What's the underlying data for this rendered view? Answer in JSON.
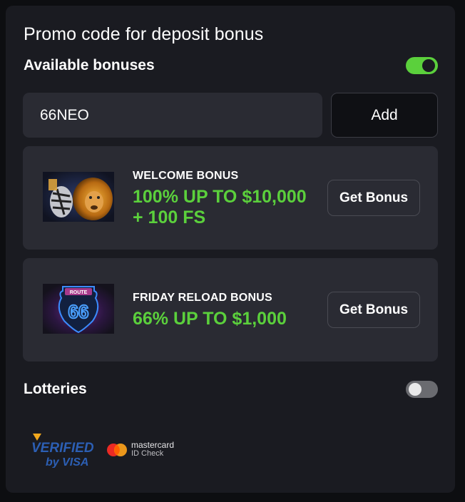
{
  "header": {
    "title": "Promo code for deposit bonus"
  },
  "bonuses_section": {
    "label": "Available bonuses",
    "toggle_on": true
  },
  "promo": {
    "value": "66NEO",
    "add_label": "Add"
  },
  "cards": [
    {
      "caption": "WELCOME BONUS",
      "offer": "100% UP TO $10,000 + 100 FS",
      "button": "Get Bonus",
      "image": "lions-icon"
    },
    {
      "caption": "FRIDAY RELOAD BONUS",
      "offer": "66% UP TO $1,000",
      "button": "Get Bonus",
      "image": "route-66-icon"
    }
  ],
  "lotteries": {
    "label": "Lotteries",
    "toggle_on": false
  },
  "footer": {
    "visa_line1": "VERIFIED",
    "visa_line2": "by VISA",
    "mc_line1": "mastercard",
    "mc_line2": "ID Check"
  },
  "colors": {
    "accent": "#5bd03c",
    "panel": "#1a1b21",
    "card": "#2a2b33"
  }
}
